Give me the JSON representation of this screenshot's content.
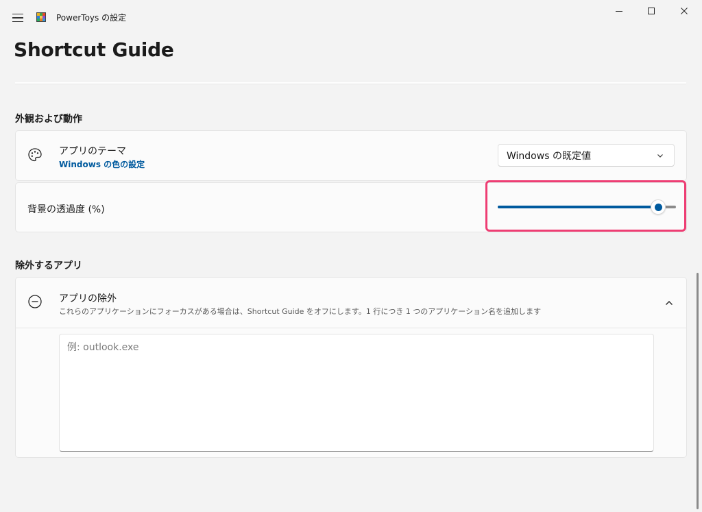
{
  "window": {
    "title": "PowerToys の設定",
    "icon": "powertoys-icon"
  },
  "page": {
    "title": "Shortcut Guide"
  },
  "appearance": {
    "header": "外観および動作",
    "theme": {
      "title": "アプリのテーマ",
      "link": "Windows の色の設定",
      "icon": "palette-icon",
      "selected": "Windows の既定値"
    },
    "opacity": {
      "title": "背景の透過度 (%)",
      "value_fraction": 0.9
    }
  },
  "excluded": {
    "header": "除外するアプリ",
    "title": "アプリの除外",
    "description": "これらのアプリケーションにフォーカスがある場合は、Shortcut Guide をオフにします。1 行につき 1 つのアプリケーション名を追加します",
    "icon": "minus-circle-icon",
    "placeholder": "例: outlook.exe",
    "value": ""
  },
  "colors": {
    "accent": "#005a9e",
    "highlight": "#ee3d73"
  }
}
